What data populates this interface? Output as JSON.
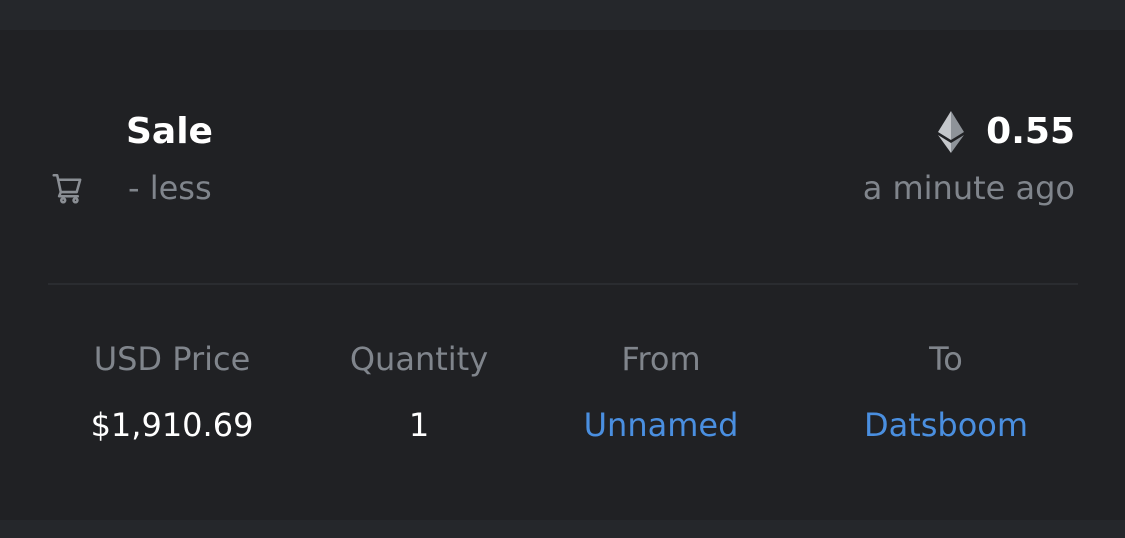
{
  "event": {
    "icon": "shopping-cart-icon",
    "type_label": "Sale",
    "subtitle": "- less"
  },
  "price": {
    "currency_icon": "ethereum-icon",
    "value": "0.55",
    "time_ago": "a minute ago"
  },
  "details": {
    "usd_price_label": "USD Price",
    "usd_price_value": "$1,910.69",
    "quantity_label": "Quantity",
    "quantity_value": "1",
    "from_label": "From",
    "from_value": "Unnamed",
    "to_label": "To",
    "to_value": "Datsboom"
  },
  "colors": {
    "page_background": "#25272b",
    "card_background": "#202124",
    "primary_text": "#ffffff",
    "muted_text": "#80858c",
    "link": "#4a8fe0"
  }
}
